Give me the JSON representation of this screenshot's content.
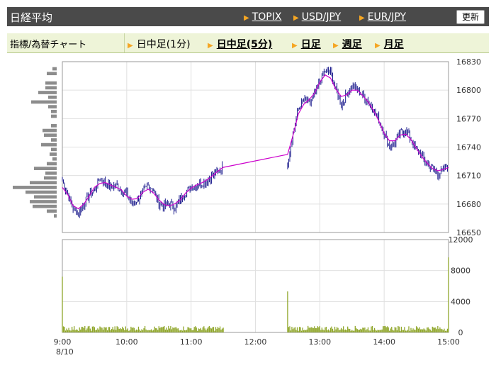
{
  "header": {
    "title": "日経平均",
    "links": [
      "TOPIX",
      "USD/JPY",
      "EUR/JPY"
    ],
    "refresh_label": "更新"
  },
  "subnav": {
    "label": "指標/為替チャート",
    "tabs": [
      "日中足(1分)",
      "日中足(5分)",
      "日足",
      "週足",
      "月足"
    ],
    "active_tab": "日中足(1分)"
  },
  "colors": {
    "topbar": "#4a4a4a",
    "subbar": "#eef4d8",
    "candle": "#1a1a8c",
    "moving_average": "#cc00cc",
    "volume": "#8fa62a",
    "volume_profile": "#8c8c8c"
  },
  "chart_data": [
    {
      "type": "candlestick",
      "name": "price",
      "x_ticks": [
        "9:00",
        "10:00",
        "11:00",
        "12:00",
        "13:00",
        "14:00",
        "15:00"
      ],
      "date_label": "8/10",
      "y_ticks": [
        16650,
        16680,
        16710,
        16740,
        16770,
        16800,
        16830
      ],
      "ylim": [
        16650,
        16830
      ],
      "grid": true,
      "overlay": "moving average",
      "close_path": [
        [
          "9:00",
          16705
        ],
        [
          "9:05",
          16690
        ],
        [
          "9:10",
          16675
        ],
        [
          "9:15",
          16670
        ],
        [
          "9:20",
          16680
        ],
        [
          "9:25",
          16690
        ],
        [
          "9:30",
          16695
        ],
        [
          "9:35",
          16708
        ],
        [
          "9:40",
          16702
        ],
        [
          "9:45",
          16698
        ],
        [
          "9:50",
          16700
        ],
        [
          "9:55",
          16695
        ],
        [
          "10:00",
          16690
        ],
        [
          "10:05",
          16680
        ],
        [
          "10:10",
          16685
        ],
        [
          "10:15",
          16692
        ],
        [
          "10:20",
          16700
        ],
        [
          "10:25",
          16695
        ],
        [
          "10:30",
          16680
        ],
        [
          "10:35",
          16678
        ],
        [
          "10:40",
          16680
        ],
        [
          "10:45",
          16676
        ],
        [
          "10:50",
          16685
        ],
        [
          "10:55",
          16692
        ],
        [
          "11:00",
          16698
        ],
        [
          "11:05",
          16700
        ],
        [
          "11:10",
          16702
        ],
        [
          "11:15",
          16705
        ],
        [
          "11:20",
          16710
        ],
        [
          "11:25",
          16714
        ],
        [
          "11:30",
          16720
        ],
        [
          "12:30",
          16722
        ],
        [
          "12:35",
          16755
        ],
        [
          "12:40",
          16780
        ],
        [
          "12:45",
          16790
        ],
        [
          "12:50",
          16785
        ],
        [
          "12:55",
          16795
        ],
        [
          "13:00",
          16810
        ],
        [
          "13:05",
          16820
        ],
        [
          "13:10",
          16818
        ],
        [
          "13:15",
          16800
        ],
        [
          "13:20",
          16785
        ],
        [
          "13:25",
          16795
        ],
        [
          "13:30",
          16805
        ],
        [
          "13:35",
          16800
        ],
        [
          "13:40",
          16795
        ],
        [
          "13:45",
          16788
        ],
        [
          "13:50",
          16780
        ],
        [
          "13:55",
          16768
        ],
        [
          "14:00",
          16755
        ],
        [
          "14:05",
          16740
        ],
        [
          "14:10",
          16745
        ],
        [
          "14:15",
          16755
        ],
        [
          "14:20",
          16758
        ],
        [
          "14:25",
          16748
        ],
        [
          "14:30",
          16738
        ],
        [
          "14:35",
          16730
        ],
        [
          "14:40",
          16722
        ],
        [
          "14:45",
          16718
        ],
        [
          "14:50",
          16712
        ],
        [
          "14:55",
          16715
        ],
        [
          "15:00",
          16722
        ]
      ]
    },
    {
      "type": "bar",
      "name": "volume",
      "x_ticks": [
        "9:00",
        "10:00",
        "11:00",
        "12:00",
        "13:00",
        "14:00",
        "15:00"
      ],
      "y_ticks": [
        0,
        4000,
        8000,
        12000
      ],
      "ylim": [
        0,
        12000
      ],
      "grid": true,
      "notable_bars": [
        [
          "9:00",
          7200
        ],
        [
          "12:30",
          5300
        ],
        [
          "15:00",
          9700
        ]
      ],
      "typical_bar": 500
    },
    {
      "type": "bar",
      "name": "volume profile",
      "orientation": "horizontal",
      "ylim": [
        16650,
        16830
      ]
    }
  ]
}
